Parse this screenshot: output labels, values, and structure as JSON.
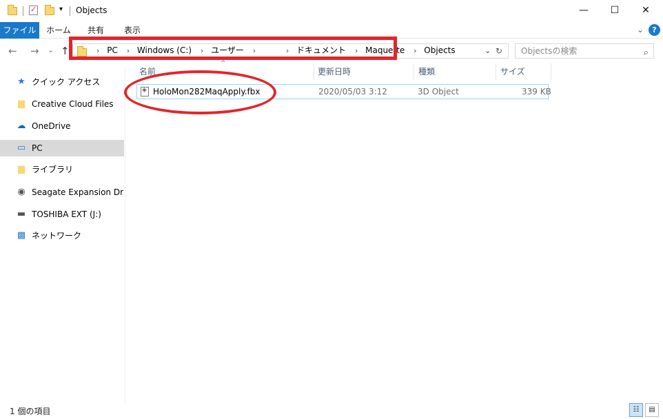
{
  "window": {
    "title": "Objects",
    "minimize_icon": "—",
    "maximize_icon": "☐",
    "close_icon": "✕"
  },
  "ribbon": {
    "tabs": [
      "ファイル",
      "ホーム",
      "共有",
      "表示"
    ],
    "expand_icon": "⌄",
    "help_icon": "?"
  },
  "navigation": {
    "back_icon": "←",
    "forward_icon": "→",
    "recent_icon": "⌄",
    "up_icon": "↑"
  },
  "address": {
    "crumbs": [
      "PC",
      "Windows (C:)",
      "ユーザー",
      "",
      "ドキュメント",
      "Maquette",
      "Objects"
    ],
    "separator": "›",
    "dropdown_icon": "⌄",
    "refresh_icon": "↻"
  },
  "search": {
    "placeholder": "Objectsの検索",
    "icon": "⌕"
  },
  "sidebar": {
    "items": [
      {
        "label": "クイック アクセス",
        "icon": "★",
        "icon_color": "#2b7bd4"
      },
      {
        "label": "Creative Cloud Files",
        "icon": "▆",
        "icon_color": "#f8d775"
      },
      {
        "label": "OneDrive",
        "icon": "☁",
        "icon_color": "#0f6cbd"
      },
      {
        "label": "PC",
        "icon": "▭",
        "icon_color": "#2b7bd4"
      },
      {
        "label": "ライブラリ",
        "icon": "▆",
        "icon_color": "#f8d775"
      },
      {
        "label": "Seagate Expansion Drive (",
        "icon": "◉",
        "icon_color": "#555555"
      },
      {
        "label": "TOSHIBA EXT (J:)",
        "icon": "▬",
        "icon_color": "#555555"
      },
      {
        "label": "ネットワーク",
        "icon": "▩",
        "icon_color": "#2b7bd4"
      }
    ],
    "selected_index": 3
  },
  "columns": {
    "name": "名前",
    "date": "更新日時",
    "type": "種類",
    "size": "サイズ",
    "sort_icon": "^"
  },
  "files": [
    {
      "name": "HoloMon282MaqApply.fbx",
      "modified": "2020/05/03 3:12",
      "type": "3D Object",
      "size": "339 KB"
    }
  ],
  "status": {
    "item_count": "1 個の項目",
    "details_view_icon": "☷",
    "large_icons_view_icon": "▤"
  },
  "annotation_color": "#e2252b"
}
